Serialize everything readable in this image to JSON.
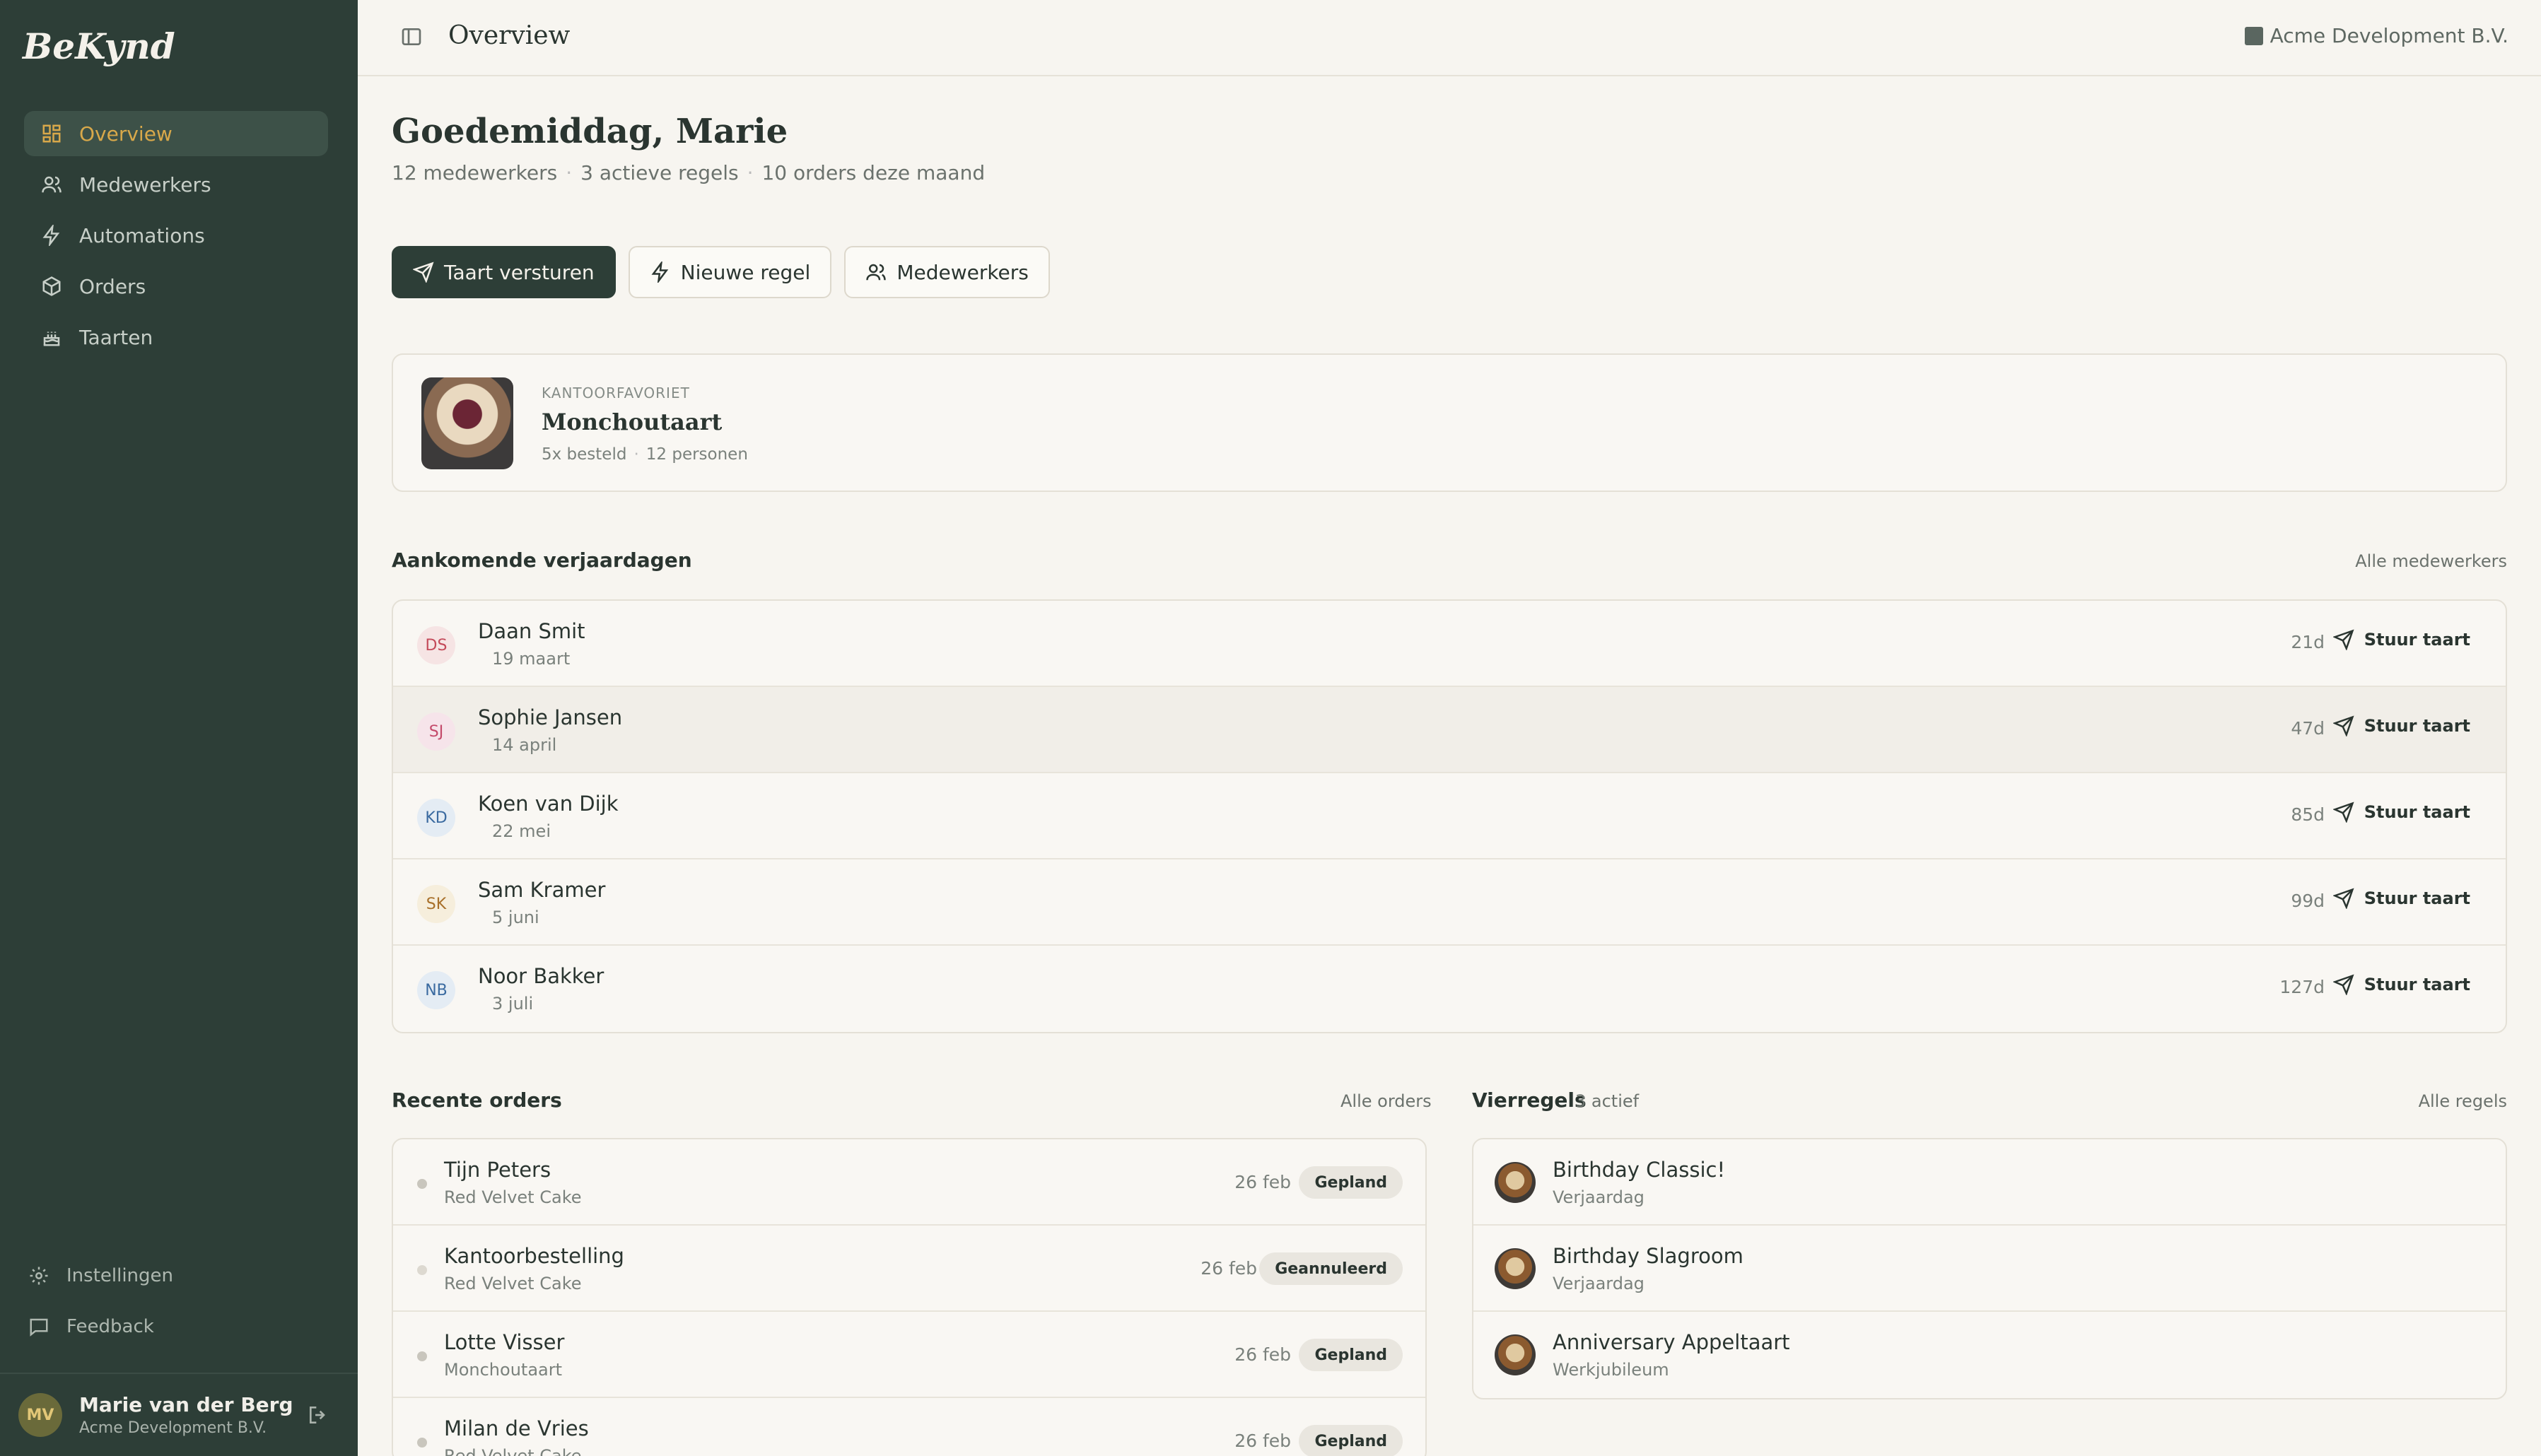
{
  "app": {
    "logo": "BeKynd"
  },
  "sidebar": {
    "items": [
      {
        "label": "Overview",
        "icon": "grid-icon",
        "active": true
      },
      {
        "label": "Medewerkers",
        "icon": "users-icon"
      },
      {
        "label": "Automations",
        "icon": "bolt-icon"
      },
      {
        "label": "Orders",
        "icon": "box-icon"
      },
      {
        "label": "Taarten",
        "icon": "cake-icon"
      }
    ],
    "bottom": [
      {
        "label": "Instellingen",
        "icon": "gear-icon"
      },
      {
        "label": "Feedback",
        "icon": "message-icon"
      }
    ],
    "user": {
      "initials": "MV",
      "name": "Marie van der Berg",
      "org": "Acme Development B.V."
    }
  },
  "topbar": {
    "title": "Overview",
    "org": "Acme Development B.V."
  },
  "main": {
    "greeting": "Goedemiddag, Marie",
    "stats": [
      "12 medewerkers",
      "3 actieve regels",
      "10 orders deze maand"
    ],
    "actions": {
      "send": "Taart versturen",
      "rule": "Nieuwe regel",
      "employees": "Medewerkers"
    },
    "favorite": {
      "kicker": "KANTOORFAVORIET",
      "name": "Monchoutaart",
      "ordered": "5x besteld",
      "people": "12 personen"
    },
    "birthdays": {
      "title": "Aankomende verjaardagen",
      "link": "Alle medewerkers",
      "send_label": "Stuur taart",
      "rows": [
        {
          "initials": "DS",
          "name": "Daan Smit",
          "date": "19 maart",
          "days": "21d",
          "color": "#c44a5a",
          "bg": "#f6e4e4"
        },
        {
          "initials": "SJ",
          "name": "Sophie Jansen",
          "date": "14 april",
          "days": "47d",
          "color": "#c44a6a",
          "bg": "#f6e4ea"
        },
        {
          "initials": "KD",
          "name": "Koen van Dijk",
          "date": "22 mei",
          "days": "85d",
          "color": "#3a6aa0",
          "bg": "#e4ecf4"
        },
        {
          "initials": "SK",
          "name": "Sam Kramer",
          "date": "5 juni",
          "days": "99d",
          "color": "#a8702a",
          "bg": "#f6eedc"
        },
        {
          "initials": "NB",
          "name": "Noor Bakker",
          "date": "3 juli",
          "days": "127d",
          "color": "#3a6aa0",
          "bg": "#e4ecf4"
        }
      ]
    },
    "orders": {
      "title": "Recente orders",
      "link": "Alle orders",
      "rows": [
        {
          "name": "Tijn Peters",
          "cake": "Red Velvet Cake",
          "date": "26 feb",
          "status": "Gepland"
        },
        {
          "name": "Kantoorbestelling",
          "cake": "Red Velvet Cake",
          "date": "26 feb",
          "status": "Geannuleerd"
        },
        {
          "name": "Lotte Visser",
          "cake": "Monchoutaart",
          "date": "26 feb",
          "status": "Gepland"
        },
        {
          "name": "Milan de Vries",
          "cake": "Red Velvet Cake",
          "date": "26 feb",
          "status": "Gepland"
        }
      ]
    },
    "rules": {
      "title": "Vierregels",
      "count": "3 actief",
      "link": "Alle regels",
      "rows": [
        {
          "name": "Birthday Classic!",
          "type": "Verjaardag"
        },
        {
          "name": "Birthday Slagroom",
          "type": "Verjaardag"
        },
        {
          "name": "Anniversary Appeltaart",
          "type": "Werkjubileum"
        }
      ]
    }
  }
}
